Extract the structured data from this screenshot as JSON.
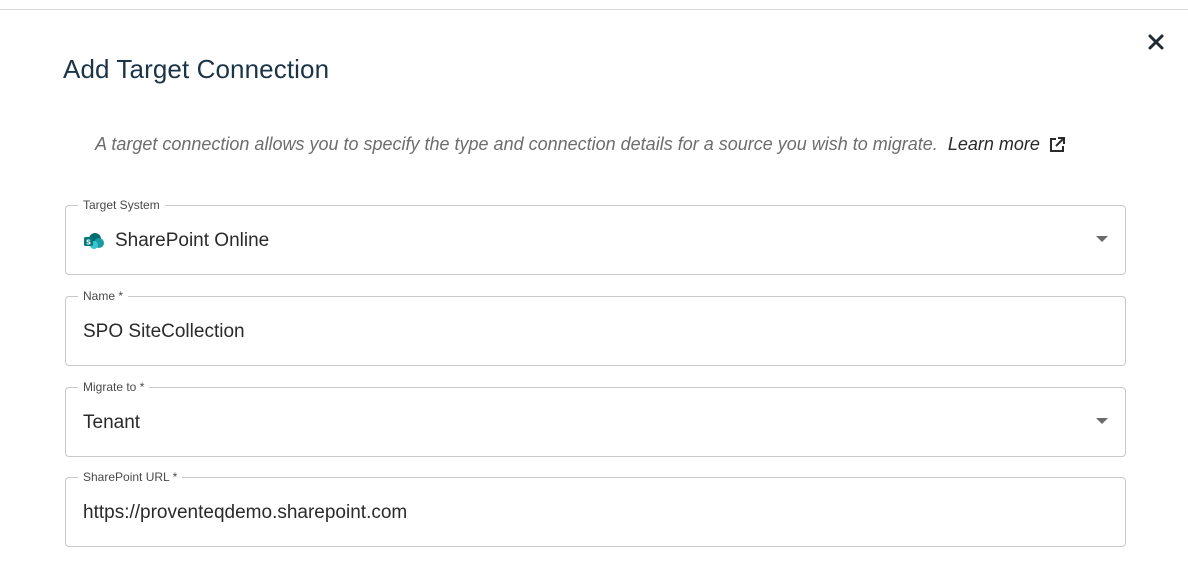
{
  "dialog": {
    "title": "Add Target Connection",
    "close_icon": "close-icon",
    "description": "A target connection allows you to specify the type and connection details for a source you wish to migrate.",
    "learn_more": "Learn more",
    "learn_more_icon": "external-link-icon"
  },
  "fields": {
    "target_system": {
      "label": "Target System",
      "value": "SharePoint Online",
      "icon": "sharepoint-icon"
    },
    "name": {
      "label": "Name *",
      "value": "SPO SiteCollection"
    },
    "migrate_to": {
      "label": "Migrate to *",
      "value": "Tenant"
    },
    "sharepoint_url": {
      "label": "SharePoint URL *",
      "value": "https://proventeqdemo.sharepoint.com"
    }
  },
  "colors": {
    "title": "#1b3447",
    "border": "#c8c8c8",
    "sharepoint_teal": "#03787c"
  }
}
